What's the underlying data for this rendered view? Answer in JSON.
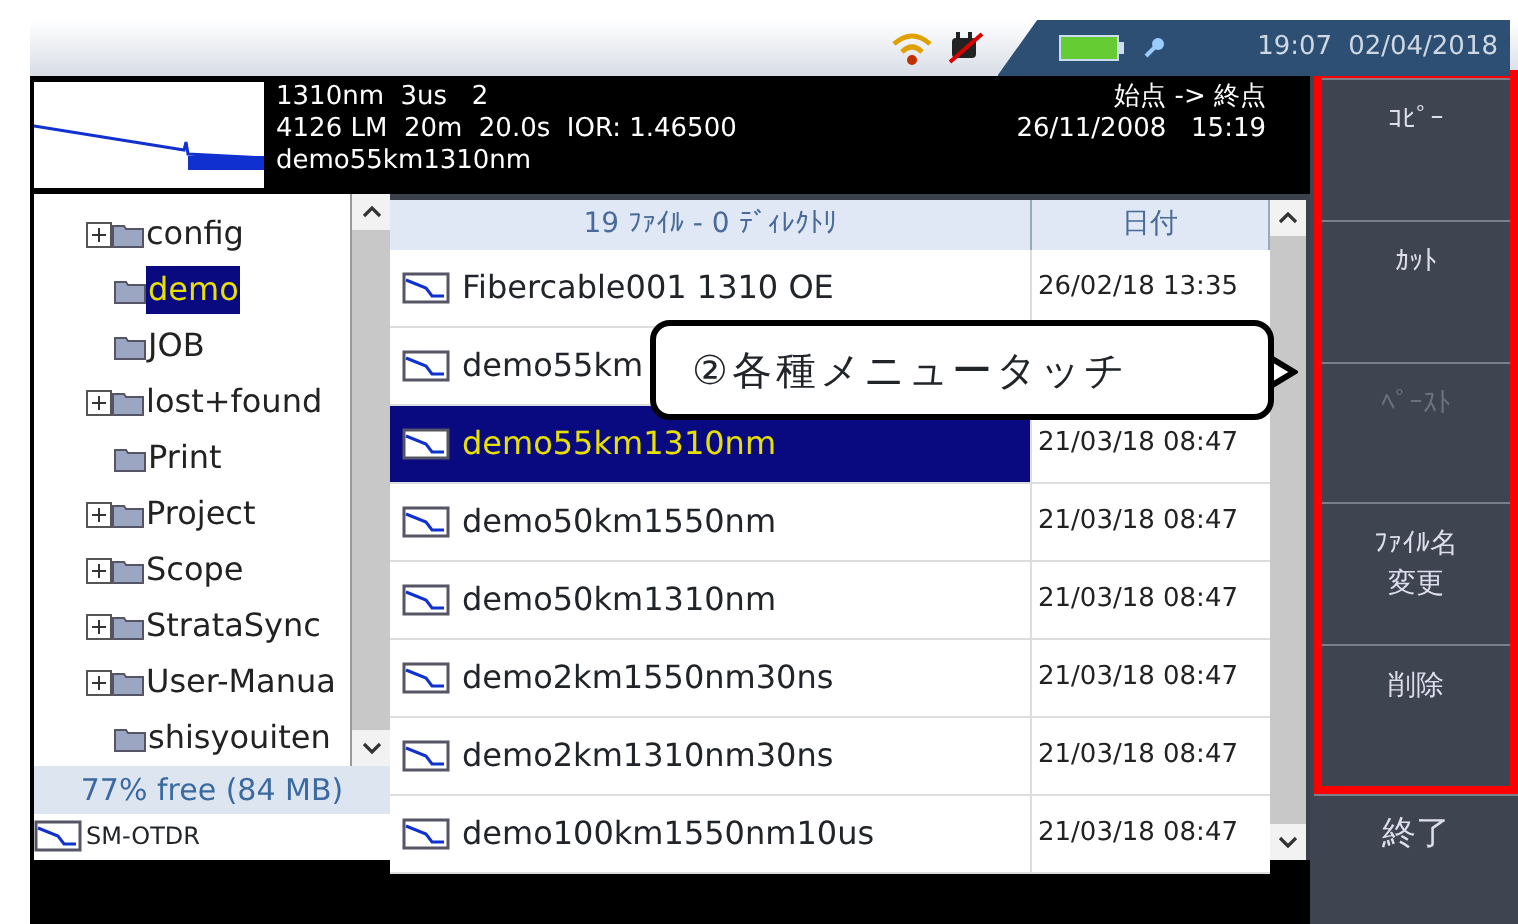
{
  "status_bar": {
    "time": "19:07",
    "date": "02/04/2018"
  },
  "trace_info": {
    "lines": [
      "1310nm  3us   2",
      "4126 LM  20m  20.0s  IOR: 1.46500",
      "demo55km1310nm"
    ],
    "direction": "始点 -> 終点",
    "timestamp": "26/11/2008   15:19"
  },
  "folder_tree": {
    "items": [
      {
        "name": "config",
        "expandable": true,
        "selected": false
      },
      {
        "name": "demo",
        "expandable": false,
        "selected": true
      },
      {
        "name": "JOB",
        "expandable": false,
        "selected": false
      },
      {
        "name": "lost+found",
        "expandable": true,
        "selected": false
      },
      {
        "name": "Print",
        "expandable": false,
        "selected": false
      },
      {
        "name": "Project",
        "expandable": true,
        "selected": false
      },
      {
        "name": "Scope",
        "expandable": true,
        "selected": false
      },
      {
        "name": "StrataSync",
        "expandable": true,
        "selected": false
      },
      {
        "name": "User-Manua",
        "expandable": true,
        "selected": false
      },
      {
        "name": "shisyouiten",
        "expandable": false,
        "selected": false
      }
    ],
    "free_space": "77% free (84 MB)"
  },
  "mode_tab": "SM-OTDR",
  "file_table": {
    "columns": [
      "19 ﾌｧｲﾙ - 0 ﾃﾞｨﾚｸﾄﾘ",
      "日付"
    ],
    "rows": [
      {
        "name": "Fibercable001 1310 OE",
        "date": "26/02/18 13:35",
        "selected": false
      },
      {
        "name": "demo55km",
        "date": "",
        "selected": false
      },
      {
        "name": "demo55km1310nm",
        "date": "21/03/18 08:47",
        "selected": true
      },
      {
        "name": "demo50km1550nm",
        "date": "21/03/18 08:47",
        "selected": false
      },
      {
        "name": "demo50km1310nm",
        "date": "21/03/18 08:47",
        "selected": false
      },
      {
        "name": "demo2km1550nm30ns",
        "date": "21/03/18 08:47",
        "selected": false
      },
      {
        "name": "demo2km1310nm30ns",
        "date": "21/03/18 08:47",
        "selected": false
      },
      {
        "name": "demo100km1550nm10us",
        "date": "21/03/18 08:47",
        "selected": false
      }
    ]
  },
  "callout": "②各種メニュータッチ",
  "menu": {
    "buttons": [
      {
        "label": [
          "ｺﾋﾟｰ"
        ],
        "disabled": false
      },
      {
        "label": [
          "ｶｯﾄ"
        ],
        "disabled": false
      },
      {
        "label": [
          "ﾍﾟｰｽﾄ"
        ],
        "disabled": true
      },
      {
        "label": [
          "ﾌｧｲﾙ名",
          "変更"
        ],
        "disabled": false
      },
      {
        "label": [
          "削除"
        ],
        "disabled": false
      }
    ],
    "exit": "終了"
  }
}
